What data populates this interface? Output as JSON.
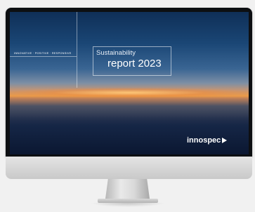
{
  "report": {
    "tagline": "INNOVATIVE · POSITIVE · RESPONSIVE",
    "title_line1": "Sustainability",
    "title_line2": "report 2023"
  },
  "brand": {
    "name": "innospec",
    "arrow_icon": "play-arrow-icon"
  },
  "colors": {
    "sky_top": "#0f2f57",
    "horizon": "#eb9a48",
    "water_bottom": "#0b1731",
    "bezel": "#0d0f12",
    "chin": "#d8d8d8"
  }
}
